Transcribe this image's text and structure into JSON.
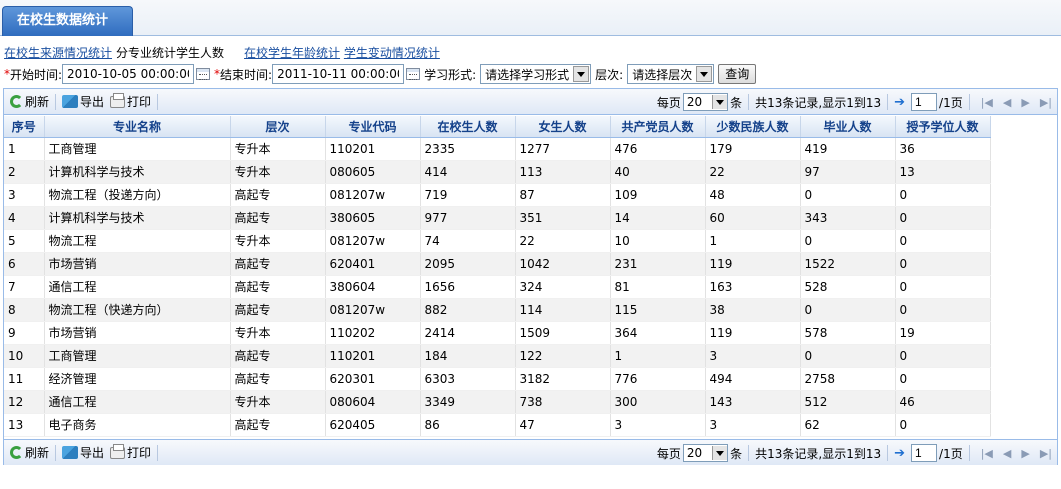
{
  "tab": {
    "title": "在校生数据统计"
  },
  "links": {
    "source": "在校生来源情况统计",
    "current": "分专业统计学生人数",
    "age": "在校学生年龄统计",
    "change": "学生变动情况统计"
  },
  "filters": {
    "start_label": "开始时间:",
    "start_value": "2010-10-05 00:00:00",
    "end_label": "结束时间:",
    "end_value": "2011-10-11 00:00:00",
    "form_label": "学习形式:",
    "form_value": "请选择学习形式",
    "level_label": "层次:",
    "level_value": "请选择层次",
    "query": "查询",
    "required_mark": "*"
  },
  "toolbar": {
    "refresh": "刷新",
    "export": "导出",
    "print": "打印",
    "per_page_label": "每页",
    "per_page": "20",
    "per_page_unit": "条",
    "records": "共13条记录,显示1到13",
    "page": "1",
    "total_pages": "/1页"
  },
  "table": {
    "columns": [
      "序号",
      "专业名称",
      "层次",
      "专业代码",
      "在校生人数",
      "女生人数",
      "共产党员人数",
      "少数民族人数",
      "毕业人数",
      "授予学位人数"
    ],
    "rows": [
      [
        "1",
        "工商管理",
        "专升本",
        "110201",
        "2335",
        "1277",
        "476",
        "179",
        "419",
        "36"
      ],
      [
        "2",
        "计算机科学与技术",
        "专升本",
        "080605",
        "414",
        "113",
        "40",
        "22",
        "97",
        "13"
      ],
      [
        "3",
        "物流工程（投递方向）",
        "高起专",
        "081207w",
        "719",
        "87",
        "109",
        "48",
        "0",
        "0"
      ],
      [
        "4",
        "计算机科学与技术",
        "高起专",
        "380605",
        "977",
        "351",
        "14",
        "60",
        "343",
        "0"
      ],
      [
        "5",
        "物流工程",
        "专升本",
        "081207w",
        "74",
        "22",
        "10",
        "1",
        "0",
        "0"
      ],
      [
        "6",
        "市场营销",
        "高起专",
        "620401",
        "2095",
        "1042",
        "231",
        "119",
        "1522",
        "0"
      ],
      [
        "7",
        "通信工程",
        "高起专",
        "380604",
        "1656",
        "324",
        "81",
        "163",
        "528",
        "0"
      ],
      [
        "8",
        "物流工程（快递方向）",
        "高起专",
        "081207w",
        "882",
        "114",
        "115",
        "38",
        "0",
        "0"
      ],
      [
        "9",
        "市场营销",
        "专升本",
        "110202",
        "2414",
        "1509",
        "364",
        "119",
        "578",
        "19"
      ],
      [
        "10",
        "工商管理",
        "高起专",
        "110201",
        "184",
        "122",
        "1",
        "3",
        "0",
        "0"
      ],
      [
        "11",
        "经济管理",
        "高起专",
        "620301",
        "6303",
        "3182",
        "776",
        "494",
        "2758",
        "0"
      ],
      [
        "12",
        "通信工程",
        "专升本",
        "080604",
        "3349",
        "738",
        "300",
        "143",
        "512",
        "46"
      ],
      [
        "13",
        "电子商务",
        "高起专",
        "620405",
        "86",
        "47",
        "3",
        "3",
        "62",
        "0"
      ]
    ]
  }
}
